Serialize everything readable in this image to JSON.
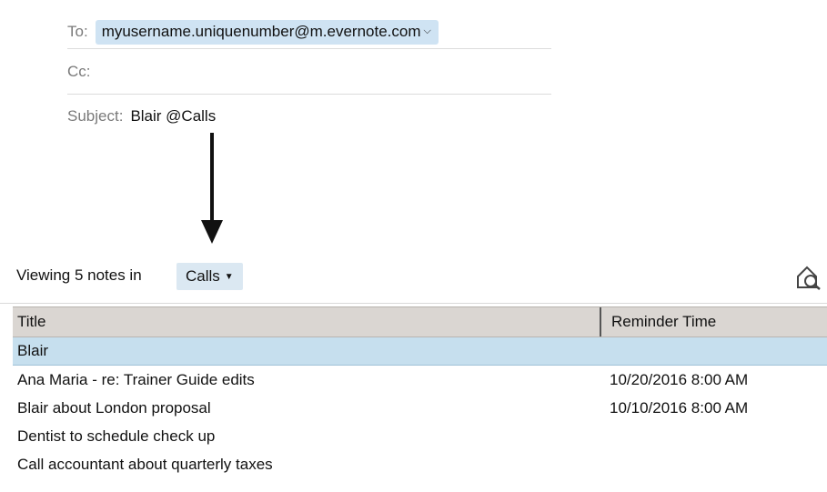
{
  "composer": {
    "to_label": "To:",
    "to_recipient": "myusername.uniquenumber@m.evernote.com",
    "cc_label": "Cc:",
    "subject_label": "Subject:",
    "subject_value": "Blair @Calls"
  },
  "note_list": {
    "viewing_label": "Viewing 5 notes in",
    "notebook_name": "Calls",
    "columns": {
      "title": "Title",
      "reminder_time": "Reminder Time"
    },
    "rows": [
      {
        "title": "Blair",
        "reminder": "",
        "selected": true
      },
      {
        "title": "Ana Maria - re: Trainer Guide edits",
        "reminder": "10/20/2016 8:00 AM"
      },
      {
        "title": "Blair about London proposal",
        "reminder": "10/10/2016 8:00 AM"
      },
      {
        "title": "Dentist to schedule check up",
        "reminder": ""
      },
      {
        "title": "Call accountant about quarterly taxes",
        "reminder": ""
      }
    ]
  },
  "icons": {
    "caret": "chevron-down-icon",
    "search": "notebook-search-icon",
    "arrow": "arrow-down-icon"
  },
  "colors": {
    "chip_bg": "#cfe3f3",
    "selected_row_bg": "#c6dfee",
    "header_bg": "#dad6d2"
  }
}
